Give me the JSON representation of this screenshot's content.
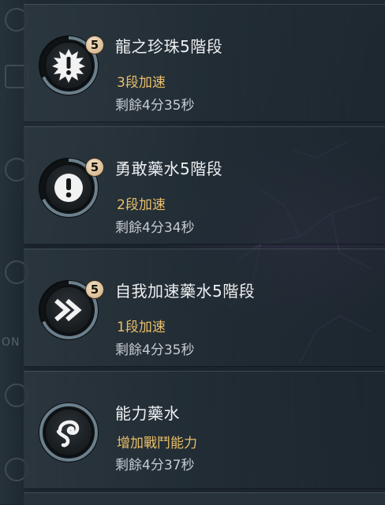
{
  "buffs": [
    {
      "title": "龍之珍珠5階段",
      "level": "5",
      "effect": "3段加速",
      "remaining": "剩餘4分35秒",
      "icon": "spiky-exclamation-icon",
      "progress": 0.68
    },
    {
      "title": "勇敢藥水5階段",
      "level": "5",
      "effect": "2段加速",
      "remaining": "剩餘4分34秒",
      "icon": "exclamation-icon",
      "progress": 0.68
    },
    {
      "title": "自我加速藥水5階段",
      "level": "5",
      "effect": "1段加速",
      "remaining": "剩餘4分35秒",
      "icon": "double-chevron-icon",
      "progress": 0.68
    },
    {
      "title": "能力藥水",
      "level": "",
      "effect": "增加戰鬥能力",
      "remaining": "剩餘4分37秒",
      "icon": "swirl-icon",
      "progress": 1.0
    }
  ],
  "sidebar": {
    "toggle_label": "ON"
  },
  "colors": {
    "title": "#eef0f1",
    "effect": "#e9bf6a",
    "remaining": "#c7ccd0",
    "ring": "#6b7f8c",
    "badge": "#d8bb92"
  }
}
